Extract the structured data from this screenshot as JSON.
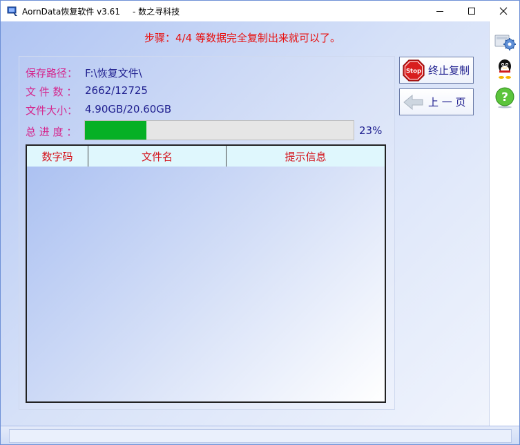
{
  "window": {
    "title": "AornData恢复软件 v3.61",
    "subtitle": "- 数之寻科技"
  },
  "step": {
    "text": "步骤：4/4 等数据完全复制出来就可以了。"
  },
  "info": {
    "save_path_label": "保存路径：",
    "save_path_value": "F:\\恢复文件\\",
    "file_count_label": "文 件 数 ：",
    "file_count_value": "2662/12725",
    "file_size_label": "文件大小：",
    "file_size_value": "4.90GB/20.60GB",
    "progress_label": "总 进 度 ：",
    "progress_percent_text": "23%",
    "progress_fraction": 0.23
  },
  "table": {
    "columns": [
      "数字码",
      "文件名",
      "提示信息"
    ],
    "rows": []
  },
  "buttons": {
    "stop_label": "终止复制",
    "prev_label": "上 一 页",
    "stop_icon_text": "Stop"
  },
  "sidebar": {
    "icons": [
      "settings-icon",
      "qq-icon",
      "help-icon"
    ]
  },
  "colors": {
    "step_text": "#e8100f",
    "label_text": "#d5268d",
    "value_text": "#1f1f8f",
    "progress_fill": "#06b025",
    "header_text": "#d4121a",
    "header_bg": "#dff7fd"
  }
}
